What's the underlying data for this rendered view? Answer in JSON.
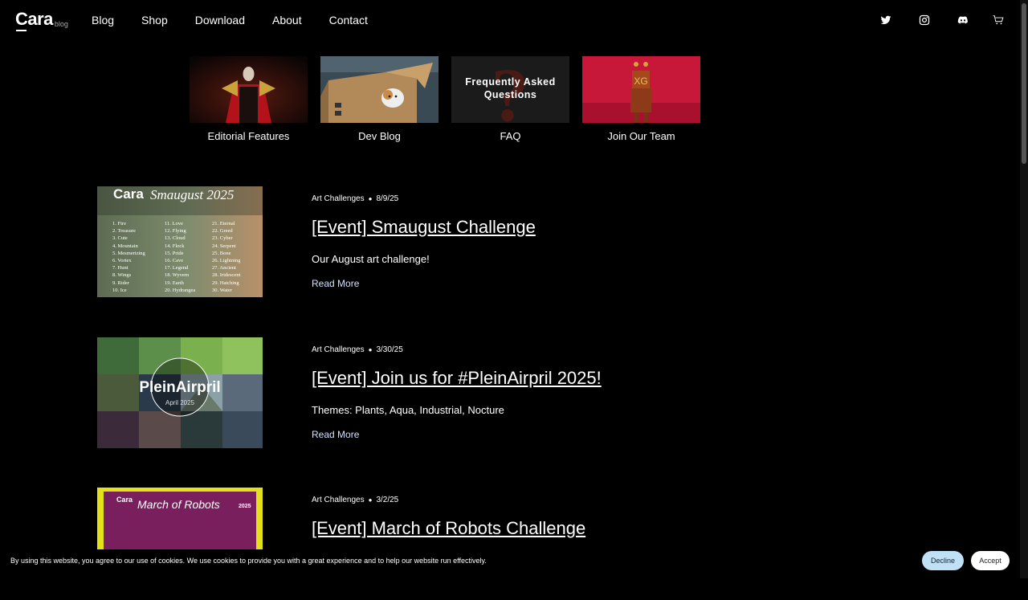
{
  "logo": {
    "text": "Cara",
    "sub": "blog"
  },
  "nav": {
    "items": [
      "Blog",
      "Shop",
      "Download",
      "About",
      "Contact"
    ]
  },
  "social": [
    "twitter-icon",
    "instagram-icon",
    "discord-icon",
    "cart-icon"
  ],
  "cards": [
    {
      "label": "Editorial Features"
    },
    {
      "label": "Dev Blog"
    },
    {
      "label": "FAQ",
      "overlay": "Frequently Asked Questions"
    },
    {
      "label": "Join Our Team"
    }
  ],
  "posts": [
    {
      "category": "Art Challenges",
      "date": "8/9/25",
      "title": "[Event] Smaugust Challenge",
      "description": "Our August art challenge!",
      "read_more": "Read More",
      "thumb": {
        "brand": "Cara",
        "heading": "Smaugust 2025",
        "col1": [
          "1. Fire",
          "2. Treasure",
          "3. Cute",
          "4. Mountain",
          "5. Mesmerizing",
          "6. Vortex",
          "7. Hunt",
          "8. Wings",
          "9. Rider",
          "10. Ice"
        ],
        "col2": [
          "11. Love",
          "12. Flying",
          "13. Cloud",
          "14. Flock",
          "15. Pride",
          "16. Cave",
          "17. Legend",
          "18. Wyvern",
          "19. Earth",
          "20. Hydrangea"
        ],
        "col3": [
          "21. Eternal",
          "22. Greed",
          "23. Cyber",
          "24. Serpent",
          "25. Bone",
          "26. Lightning",
          "27. Ancient",
          "28. Iridescent",
          "29. Hatching",
          "30. Water"
        ]
      }
    },
    {
      "category": "Art Challenges",
      "date": "3/30/25",
      "title": "[Event] Join us for #PleinAirpril 2025!",
      "description": "Themes: Plants, Aqua, Industrial, Nocture",
      "read_more": "Read More",
      "thumb": {
        "heading": "PleinAirpril",
        "sub": "April 2025"
      }
    },
    {
      "category": "Art Challenges",
      "date": "3/2/25",
      "title": "[Event] March of Robots Challenge",
      "description": "",
      "read_more": "",
      "thumb": {
        "brand": "Cara",
        "heading": "March of Robots",
        "year": "2025"
      }
    }
  ],
  "cookie": {
    "text": "By using this website, you agree to our use of cookies. We use cookies to provide you with a great experience and to help our website run effectively.",
    "decline": "Decline",
    "accept": "Accept"
  },
  "colors": {
    "background": "#000000",
    "link": "#cfe3ff",
    "decline_bg": "#bfe0f5"
  }
}
